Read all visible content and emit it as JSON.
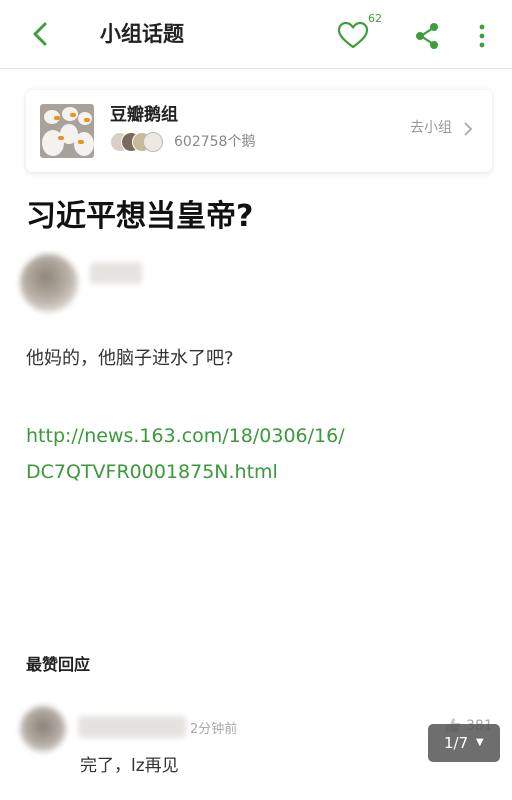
{
  "header": {
    "title": "小组话题",
    "like_count": "62"
  },
  "group": {
    "name": "豆瓣鹅组",
    "member_count": "602758个鹅",
    "join_label": "去小组"
  },
  "post": {
    "title": "习近平想当皇帝?",
    "body": "他妈的，他脑子进水了吧?",
    "link_line1": "http://news.163.com/18/0306/16/",
    "link_line2": "DC7QTVFR0001875N.html"
  },
  "replies": {
    "section_title": "最赞回应",
    "items": [
      {
        "time": "2分钟前",
        "likes": "381",
        "text": "完了，lz再见"
      }
    ]
  },
  "pager": {
    "label": "1/7",
    "caret": "▼"
  },
  "colors": {
    "accent": "#3d9e3d",
    "link": "#3a9a3a"
  },
  "icons": [
    "back-arrow-icon",
    "heart-icon",
    "share-icon",
    "more-icon",
    "chevron-right-icon",
    "thumbs-up-icon"
  ]
}
